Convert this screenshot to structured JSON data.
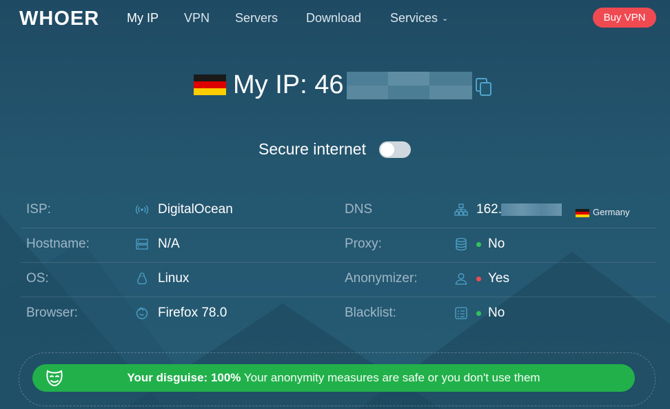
{
  "nav": {
    "logo": "WHOER",
    "items": [
      {
        "label": "My IP"
      },
      {
        "label": "VPN"
      },
      {
        "label": "Servers"
      },
      {
        "label": "Download"
      },
      {
        "label": "Services"
      }
    ],
    "buy_label": "Buy VPN"
  },
  "hero": {
    "ip_label": "My IP: 46",
    "secure_label": "Secure internet",
    "secure_enabled": false
  },
  "info": {
    "left": [
      {
        "label": "ISP:",
        "icon": "wifi-signal-icon",
        "value": "DigitalOcean"
      },
      {
        "label": "Hostname:",
        "icon": "server-icon",
        "value": "N/A"
      },
      {
        "label": "OS:",
        "icon": "linux-icon",
        "value": "Linux"
      },
      {
        "label": "Browser:",
        "icon": "firefox-icon",
        "value": "Firefox 78.0"
      }
    ],
    "right": [
      {
        "label": "DNS",
        "icon": "network-icon",
        "value": "162.",
        "country": "Germany"
      },
      {
        "label": "Proxy:",
        "icon": "database-icon",
        "value": "No",
        "status_color": "#33c25a"
      },
      {
        "label": "Anonymizer:",
        "icon": "user-icon",
        "value": "Yes",
        "status_color": "#ef4a52"
      },
      {
        "label": "Blacklist:",
        "icon": "list-icon",
        "value": "No",
        "status_color": "#33c25a"
      }
    ]
  },
  "disguise": {
    "lead": "Your disguise: 100%",
    "text": " Your anonymity measures are safe or you don't use them"
  },
  "colors": {
    "background": "#24566f",
    "accent_red": "#ef4a52",
    "success_green": "#22b04b"
  }
}
